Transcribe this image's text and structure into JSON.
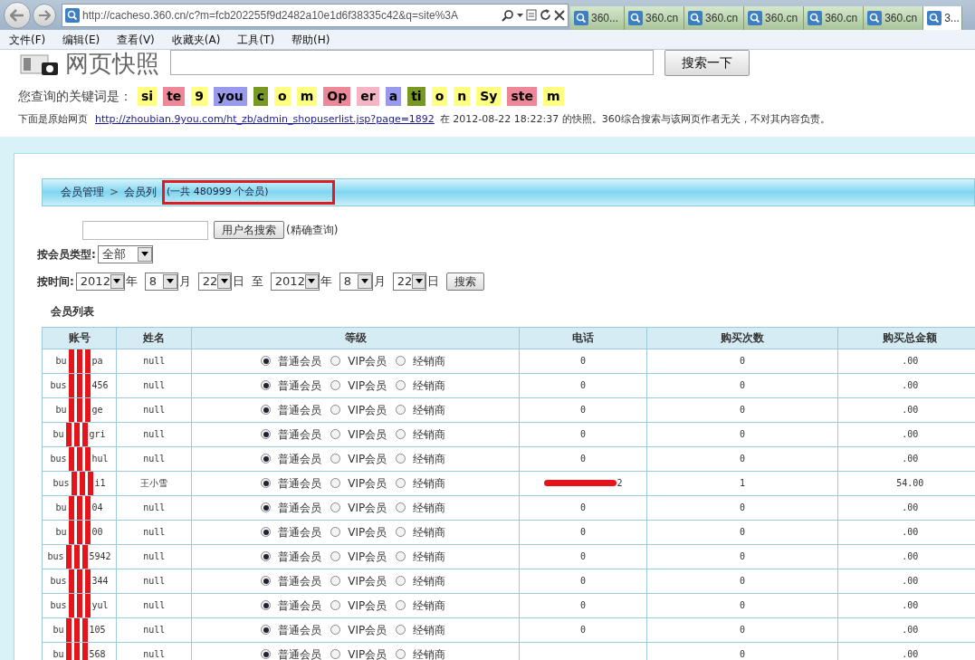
{
  "browser": {
    "address": "http://cacheso.360.cn/c?m=fcb202255f9d2482a10e1d6f38335c42&q=site%3A",
    "tabs": [
      {
        "label": "360...",
        "selected": false
      },
      {
        "label": "360.cn",
        "selected": false
      },
      {
        "label": "360.cn",
        "selected": false
      },
      {
        "label": "360.cn",
        "selected": false
      },
      {
        "label": "360.cn",
        "selected": false
      },
      {
        "label": "360.cn",
        "selected": false
      },
      {
        "label": "3...",
        "selected": true
      }
    ],
    "menu": [
      "文件(F)",
      "编辑(E)",
      "查看(V)",
      "收藏夹(A)",
      "工具(T)",
      "帮助(H)"
    ]
  },
  "snapshot": {
    "title": "网页快照",
    "search_button": "搜索一下",
    "keyword_label": "您查询的关键词是：",
    "keywords": [
      {
        "text": "si",
        "color": "#ffff80"
      },
      {
        "text": "te",
        "color": "#ee8899"
      },
      {
        "text": "9",
        "color": "#ffff80"
      },
      {
        "text": "you",
        "color": "#9999ee"
      },
      {
        "text": "c",
        "color": "#779922"
      },
      {
        "text": "o",
        "color": "#ffff80"
      },
      {
        "text": "m",
        "color": "#ffff80"
      },
      {
        "text": "Op",
        "color": "#ee8899"
      },
      {
        "text": "er",
        "color": "#f5b5c5"
      },
      {
        "text": "a",
        "color": "#9999ee"
      },
      {
        "text": "ti",
        "color": "#779922"
      },
      {
        "text": "o",
        "color": "#ffff80"
      },
      {
        "text": "n",
        "color": "#ffff80"
      },
      {
        "text": "Sy",
        "color": "#ffff80"
      },
      {
        "text": "ste",
        "color": "#ee8899"
      },
      {
        "text": "m",
        "color": "#ffff80"
      }
    ],
    "source_prefix": "下面是原始网页",
    "source_link": "http://zhoubian.9you.com/ht_zb/admin_shopuserlist.jsp?page=1892",
    "source_suffix": "在 2012-08-22 18:22:37 的快照。360综合搜索与该网页作者无关，不对其内容负责。"
  },
  "page": {
    "breadcrumb": [
      "会员管理",
      "会员列"
    ],
    "breadcrumb_sep": ">",
    "count_text": "(一共 480999 个会员)",
    "search_button": "用户名搜索",
    "search_hint": "(精确查询)",
    "type_filter": {
      "label": "按会员类型:",
      "value": "全部"
    },
    "time_filter": {
      "label": "按时间:",
      "from": [
        "2012",
        "8",
        "22"
      ],
      "to": [
        "2012",
        "8",
        "22"
      ],
      "units_from": [
        "年",
        "月",
        "日"
      ],
      "units_to": [
        "年",
        "月",
        "日"
      ],
      "between": "至",
      "button": "搜索"
    },
    "list_title": "会员列表",
    "table": {
      "columns": [
        "账号",
        "姓名",
        "等级",
        "电话",
        "购买次数",
        "购买总金额"
      ],
      "rows": [
        {
          "account": [
            "bu",
            "pa"
          ],
          "name": "null",
          "phone": "0",
          "purchases": "0",
          "total": ".00",
          "levels": [
            {
              "label": "普通会员",
              "selected": true
            },
            {
              "label": "VIP会员",
              "selected": false
            },
            {
              "label": "经销商",
              "selected": false
            }
          ]
        },
        {
          "account": [
            "bus",
            "456"
          ],
          "name": "null",
          "phone": "0",
          "purchases": "0",
          "total": ".00",
          "levels": [
            {
              "label": "普通会员",
              "selected": true
            },
            {
              "label": "VIP会员",
              "selected": false
            },
            {
              "label": "经销商",
              "selected": false
            }
          ]
        },
        {
          "account": [
            "bu",
            "ge"
          ],
          "name": "null",
          "phone": "0",
          "purchases": "0",
          "total": ".00",
          "levels": [
            {
              "label": "普通会员",
              "selected": true
            },
            {
              "label": "VIP会员",
              "selected": false
            },
            {
              "label": "经销商",
              "selected": false
            }
          ]
        },
        {
          "account": [
            "bu",
            "gri"
          ],
          "name": "null",
          "phone": "0",
          "purchases": "0",
          "total": ".00",
          "levels": [
            {
              "label": "普通会员",
              "selected": true
            },
            {
              "label": "VIP会员",
              "selected": false
            },
            {
              "label": "经销商",
              "selected": false
            }
          ]
        },
        {
          "account": [
            "bus",
            "hul"
          ],
          "name": "null",
          "phone": "0",
          "purchases": "0",
          "total": ".00",
          "levels": [
            {
              "label": "普通会员",
              "selected": true
            },
            {
              "label": "VIP会员",
              "selected": false
            },
            {
              "label": "经销商",
              "selected": false
            }
          ]
        },
        {
          "account": [
            "bus",
            "i1"
          ],
          "name": "王小雪",
          "phone": "2",
          "phone_redacted": true,
          "purchases": "1",
          "total": "54.00",
          "levels": [
            {
              "label": "普通会员",
              "selected": true
            },
            {
              "label": "VIP会员",
              "selected": false
            },
            {
              "label": "经销商",
              "selected": false
            }
          ]
        },
        {
          "account": [
            "bu",
            "04"
          ],
          "name": "null",
          "phone": "0",
          "purchases": "0",
          "total": ".00",
          "levels": [
            {
              "label": "普通会员",
              "selected": true
            },
            {
              "label": "VIP会员",
              "selected": false
            },
            {
              "label": "经销商",
              "selected": false
            }
          ]
        },
        {
          "account": [
            "bu",
            "00"
          ],
          "name": "null",
          "phone": "0",
          "purchases": "0",
          "total": ".00",
          "levels": [
            {
              "label": "普通会员",
              "selected": true
            },
            {
              "label": "VIP会员",
              "selected": false
            },
            {
              "label": "经销商",
              "selected": false
            }
          ]
        },
        {
          "account": [
            "bus",
            "5942"
          ],
          "name": "null",
          "phone": "0",
          "purchases": "0",
          "total": ".00",
          "levels": [
            {
              "label": "普通会员",
              "selected": true
            },
            {
              "label": "VIP会员",
              "selected": false
            },
            {
              "label": "经销商",
              "selected": false
            }
          ]
        },
        {
          "account": [
            "bus",
            "344"
          ],
          "name": "null",
          "phone": "0",
          "purchases": "0",
          "total": ".00",
          "levels": [
            {
              "label": "普通会员",
              "selected": true
            },
            {
              "label": "VIP会员",
              "selected": false
            },
            {
              "label": "经销商",
              "selected": false
            }
          ]
        },
        {
          "account": [
            "bus",
            "yul"
          ],
          "name": "null",
          "phone": "0",
          "purchases": "0",
          "total": ".00",
          "levels": [
            {
              "label": "普通会员",
              "selected": true
            },
            {
              "label": "VIP会员",
              "selected": false
            },
            {
              "label": "经销商",
              "selected": false
            }
          ]
        },
        {
          "account": [
            "bu",
            "105"
          ],
          "name": "null",
          "phone": "0",
          "purchases": "0",
          "total": ".00",
          "levels": [
            {
              "label": "普通会员",
              "selected": true
            },
            {
              "label": "VIP会员",
              "selected": false
            },
            {
              "label": "经销商",
              "selected": false
            }
          ]
        },
        {
          "account": [
            "bu",
            "568"
          ],
          "name": "null",
          "purchases": "0",
          "total": ".00",
          "levels": [
            {
              "label": "普通会员",
              "selected": true
            },
            {
              "label": "VIP会员",
              "selected": false
            },
            {
              "label": "经销商",
              "selected": false
            }
          ]
        }
      ]
    }
  }
}
